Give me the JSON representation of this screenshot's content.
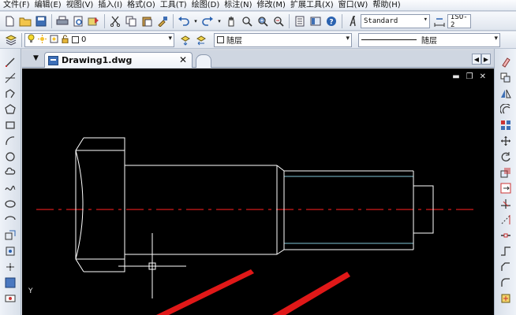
{
  "menubar": {
    "items": [
      "文件(F)",
      "编辑(E)",
      "视图(V)",
      "插入(I)",
      "格式(O)",
      "工具(T)",
      "绘图(D)",
      "标注(N)",
      "修改(M)",
      "扩展工具(X)",
      "窗口(W)",
      "帮助(H)"
    ]
  },
  "toolbar1": {
    "text_style": "Standard",
    "dim_style": "ISO-2"
  },
  "toolbar2": {
    "layer_value": "0",
    "color_value": "随层",
    "linetype_value": "随层"
  },
  "document": {
    "tab_title": "Drawing1.dwg",
    "close_glyph": "✕"
  },
  "canvas": {
    "axis_label": "Y"
  },
  "colors": {
    "drawing_line": "#ffffff",
    "centerline": "#d41a1a",
    "thread_line": "#7fc4d6",
    "annotation_arrow": "#e01818",
    "canvas_bg": "#000000"
  },
  "icons": {
    "left_toolbar": [
      "line-icon",
      "construction-line-icon",
      "polyline-icon",
      "polygon-icon",
      "rectangle-icon",
      "arc-icon",
      "circle-icon",
      "revision-cloud-icon",
      "spline-icon",
      "ellipse-icon",
      "ellipse-arc-icon",
      "insert-block-icon",
      "make-block-icon",
      "point-icon",
      "hatch-icon",
      "region-icon",
      "table-icon"
    ],
    "right_toolbar": [
      "erase-icon",
      "copy-icon",
      "mirror-icon",
      "offset-icon",
      "array-icon",
      "move-icon",
      "rotate-icon",
      "scale-icon",
      "stretch-icon",
      "trim-icon",
      "extend-icon",
      "break-icon",
      "join-icon",
      "chamfer-icon",
      "fillet-icon",
      "explode-icon"
    ]
  }
}
